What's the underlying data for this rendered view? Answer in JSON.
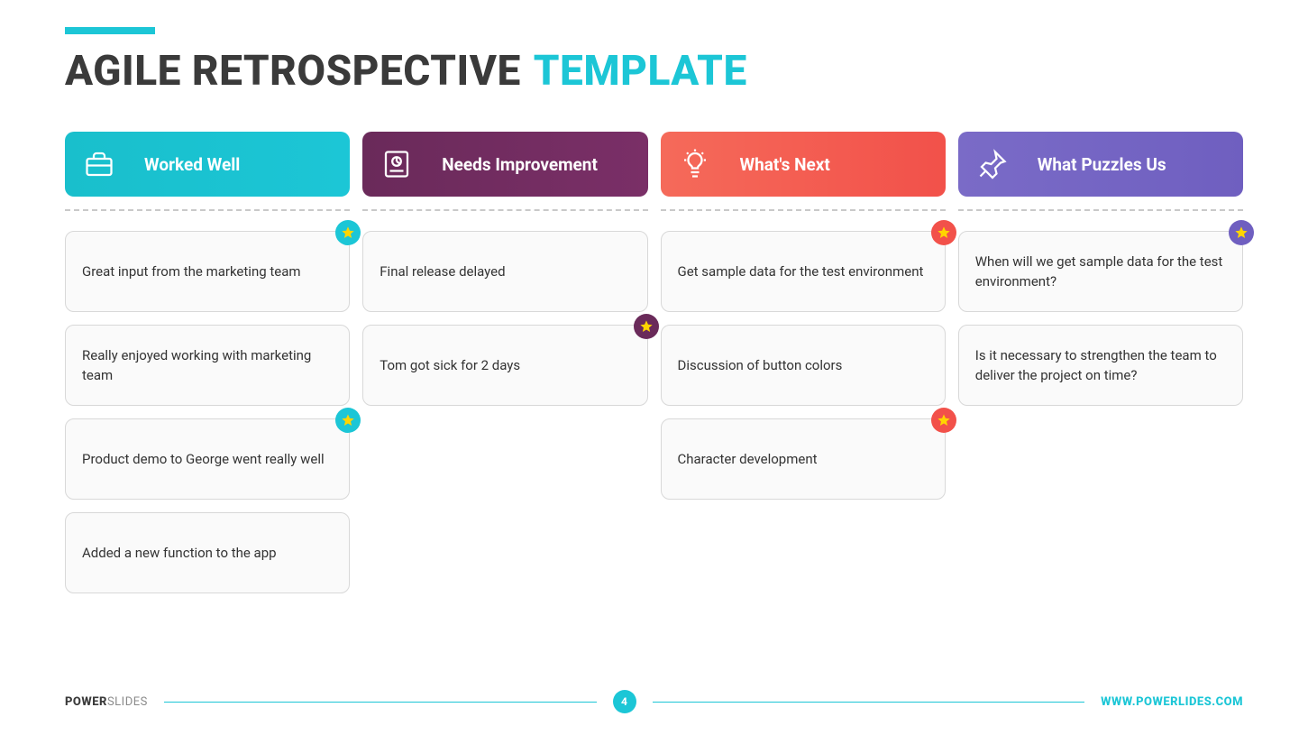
{
  "title": {
    "main": "AGILE RETROSPECTIVE",
    "template": "TEMPLATE"
  },
  "columns": [
    {
      "label": "Worked Well",
      "cards": [
        {
          "text": "Great input from the marketing team",
          "star": true
        },
        {
          "text": "Really enjoyed working with marketing team",
          "star": false
        },
        {
          "text": "Product demo to George went really well",
          "star": true
        },
        {
          "text": "Added a new function to the app",
          "star": false
        }
      ]
    },
    {
      "label": "Needs Improvement",
      "cards": [
        {
          "text": "Final release delayed",
          "star": false
        },
        {
          "text": "Tom got sick for 2 days",
          "star": true
        }
      ]
    },
    {
      "label": "What's Next",
      "cards": [
        {
          "text": "Get sample data for the test environment",
          "star": true
        },
        {
          "text": "Discussion of button colors",
          "star": false
        },
        {
          "text": "Character development",
          "star": true
        }
      ]
    },
    {
      "label": "What Puzzles Us",
      "cards": [
        {
          "text": "When will we get sample data for the test environment?",
          "star": true
        },
        {
          "text": "Is it necessary to strengthen the team to deliver the project on time?",
          "star": false
        }
      ]
    }
  ],
  "footer": {
    "brand_bold": "POWER",
    "brand_light": "SLIDES",
    "page": "4",
    "url": "WWW.POWERLIDES.COM"
  },
  "icons": {
    "briefcase": "briefcase-icon",
    "chart": "chart-icon",
    "lightbulb": "lightbulb-icon",
    "pin": "pin-icon"
  }
}
